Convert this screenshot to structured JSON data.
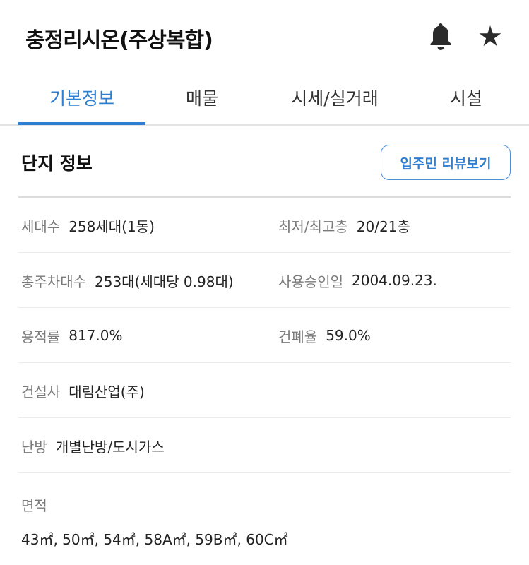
{
  "header": {
    "title": "충정리시온(주상복합)",
    "icons": {
      "bell": "bell-icon",
      "star": "star-icon"
    }
  },
  "tabs": [
    {
      "label": "기본정보",
      "active": true
    },
    {
      "label": "매물",
      "active": false
    },
    {
      "label": "시세/실거래",
      "active": false
    },
    {
      "label": "시설",
      "active": false
    }
  ],
  "section": {
    "title": "단지 정보",
    "review_button": "입주민 리뷰보기"
  },
  "info": {
    "households_label": "세대수",
    "households_value": "258세대(1동)",
    "floors_label": "최저/최고층",
    "floors_value": "20/21층",
    "parking_label": "총주차대수",
    "parking_value": "253대(세대당 0.98대)",
    "approval_label": "사용승인일",
    "approval_value": "2004.09.23.",
    "far_label": "용적률",
    "far_value": "817.0%",
    "bcr_label": "건폐율",
    "bcr_value": "59.0%",
    "builder_label": "건설사",
    "builder_value": "대림산업(주)",
    "heating_label": "난방",
    "heating_value": "개별난방/도시가스",
    "area_label": "면적",
    "area_value": "43㎡, 50㎡, 54㎡, 58A㎡, 59B㎡, 60C㎡"
  },
  "colors": {
    "accent": "#2f7fd0",
    "label": "#7a7a7a",
    "text": "#222222"
  }
}
